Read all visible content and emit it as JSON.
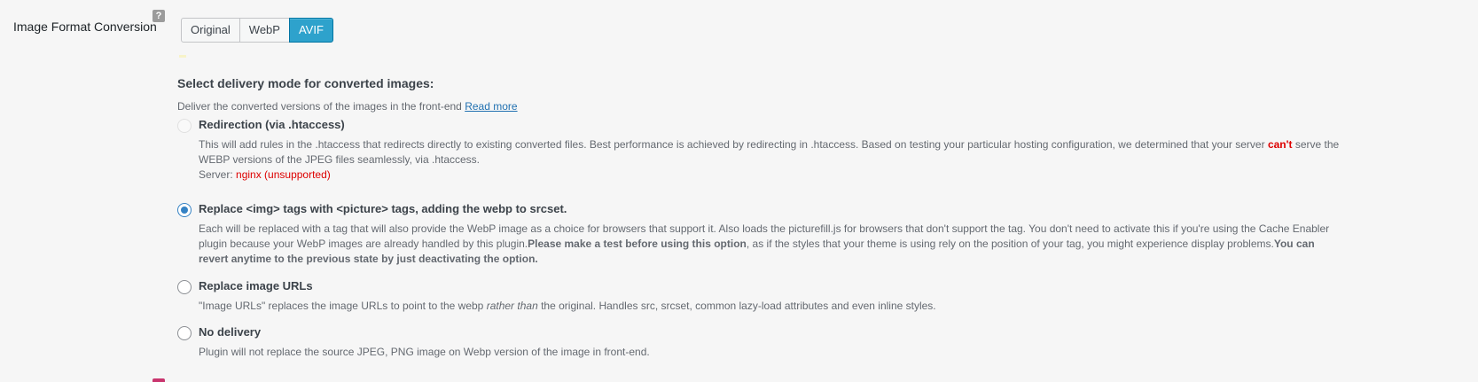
{
  "setting": {
    "label": "Image Format Conversion",
    "help_icon": "?"
  },
  "format_buttons": [
    {
      "label": "Original",
      "active": false
    },
    {
      "label": "WebP",
      "active": false
    },
    {
      "label": "AVIF",
      "active": true
    }
  ],
  "delivery": {
    "heading": "Select delivery mode for converted images:",
    "description": "Deliver the converted versions of the images in the front-end",
    "read_more": "Read more",
    "options": [
      {
        "label": "Redirection (via .htaccess)",
        "selected": false,
        "disabled": true,
        "text_1": "This will add rules in the .htaccess that redirects directly to existing converted files. Best performance is achieved by redirecting in .htaccess. Based on testing your particular hosting configuration, we determined that your server",
        "text_warn": "can't",
        "text_2": "serve the WEBP versions of the JPEG files seamlessly, via .htaccess.",
        "server_label": "Server:",
        "server_value": "nginx (unsupported)"
      },
      {
        "label": "Replace <img> tags with <picture> tags, adding the webp to srcset.",
        "selected": true,
        "text_1": "Each  will be replaced with a tag that will also provide the WebP image as a choice for browsers that support it. Also loads the picturefill.js for browsers that don't support the tag. You don't need to activate this if you're using the Cache Enabler plugin because your WebP images are already handled by this plugin.",
        "text_bold_1": "Please make a test before using this option",
        "text_2": ", as if the styles that your theme is using rely on the position of your  tag, you might experience display problems.",
        "text_bold_2": "You can revert anytime to the previous state by just deactivating the option."
      },
      {
        "label": "Replace image URLs",
        "selected": false,
        "text_1": "\"Image URLs\" replaces the image URLs to point to the webp",
        "text_italic": "rather than",
        "text_2": "the original. Handles src, srcset, common lazy-load attributes and even inline styles."
      },
      {
        "label": "No delivery",
        "selected": false,
        "text_1": "Plugin will not replace the source JPEG, PNG image on Webp version of the image in front-end."
      }
    ]
  },
  "colors": {
    "accent": "#2ea2cc",
    "radio": "#3582c4",
    "warning": "#dd0000",
    "link": "#2271b1"
  }
}
